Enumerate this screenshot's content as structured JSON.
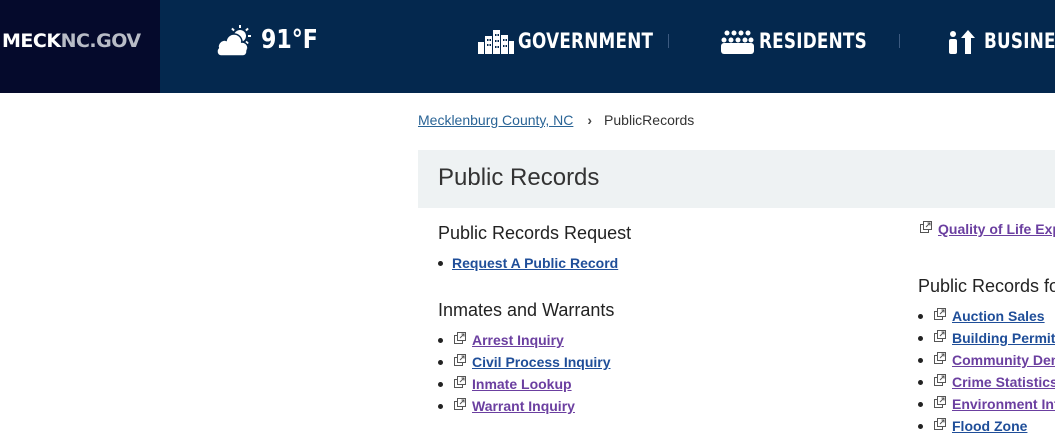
{
  "header": {
    "logo_bold": "MECK",
    "logo_light": "NC.GOV",
    "weather": {
      "icon": "partly-cloudy-icon",
      "temp": "91°F"
    },
    "nav": [
      {
        "label": "GOVERNMENT",
        "icon": "buildings-icon"
      },
      {
        "label": "RESIDENTS",
        "icon": "people-icon"
      },
      {
        "label": "BUSINES",
        "icon": "business-icon"
      }
    ]
  },
  "breadcrumb": {
    "home": "Mecklenburg County, NC",
    "current": "PublicRecords"
  },
  "page_title": "Public Records",
  "sections": {
    "request": {
      "heading": "Public Records Request",
      "items": [
        "Request A Public Record"
      ]
    },
    "inmates": {
      "heading": "Inmates and Warrants",
      "items": [
        "Arrest Inquiry",
        "Civil Process Inquiry",
        "Inmate Lookup",
        "Warrant Inquiry"
      ]
    },
    "quality_link": "Quality of Life Expl",
    "records_for": {
      "heading": "Public Records fo",
      "items": [
        "Auction Sales",
        "Building Permits",
        "Community Dem",
        "Crime Statistics",
        "Environment Info",
        "Flood Zone"
      ]
    }
  },
  "colors": {
    "header_bg": "#04284e",
    "logo_bg": "#050a2c",
    "visited_link": "#6b3fa0",
    "link": "#1f4e99",
    "title_bar_bg": "#eef2f3"
  }
}
